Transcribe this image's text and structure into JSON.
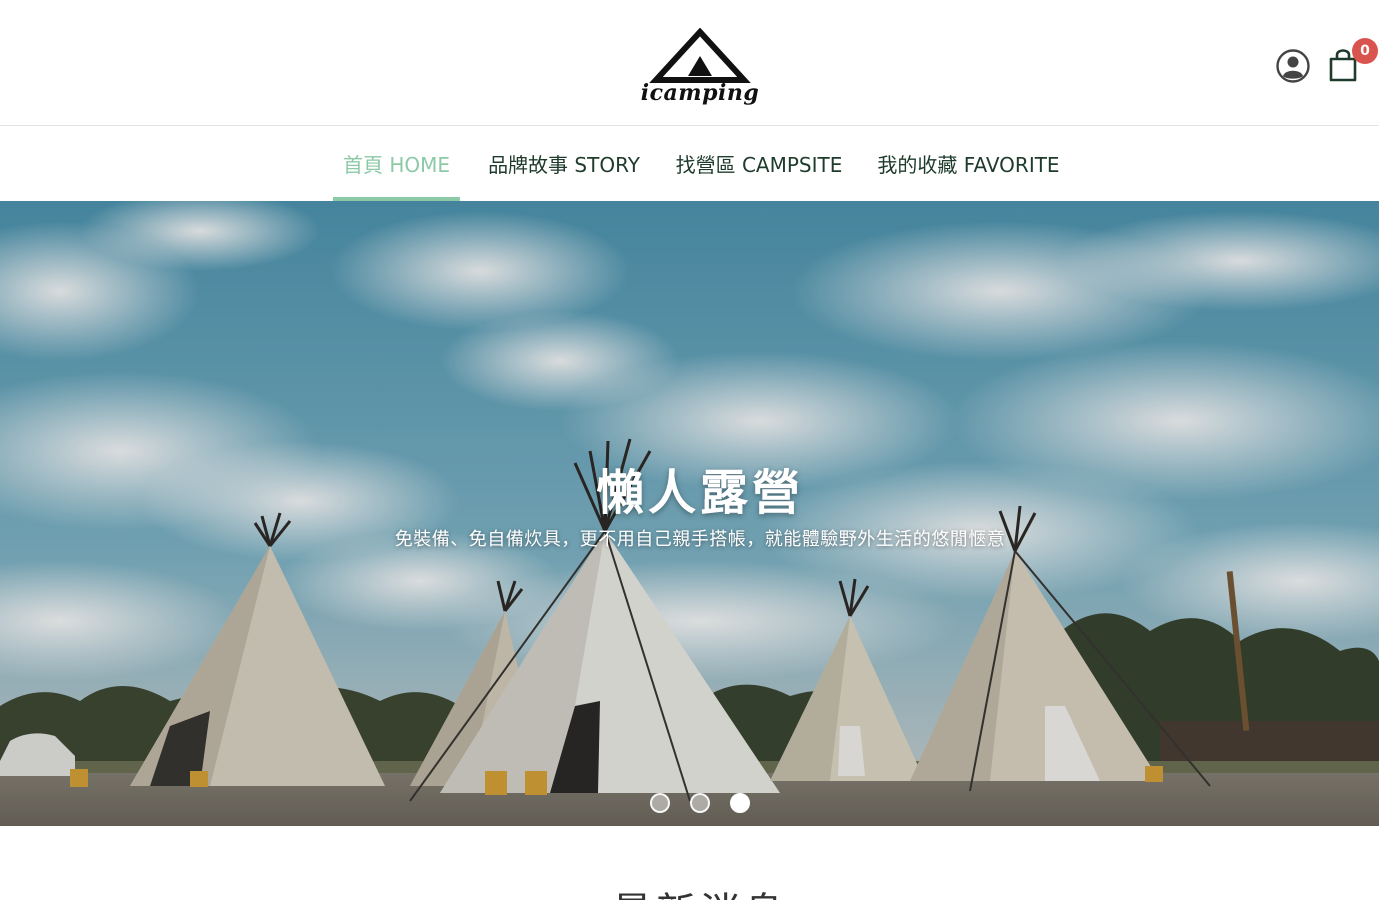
{
  "header": {
    "logo_text": "icamping",
    "cart_count": "0"
  },
  "nav": {
    "items": [
      {
        "label": "首頁 HOME",
        "active": true
      },
      {
        "label": "品牌故事 STORY",
        "active": false
      },
      {
        "label": "找營區 CAMPSITE",
        "active": false
      },
      {
        "label": "我的收藏 FAVORITE",
        "active": false
      }
    ]
  },
  "hero": {
    "title": "懶人露營",
    "subtitle": "免裝備、免自備炊具，更不用自己親手搭帳，就能體驗野外生活的悠閒愜意",
    "slides_total": 3,
    "active_slide": 3
  },
  "section": {
    "title": "最新消息"
  },
  "colors": {
    "accent": "#8cc9a6",
    "nav_text": "#1f3b2c",
    "badge": "#d9534f"
  }
}
